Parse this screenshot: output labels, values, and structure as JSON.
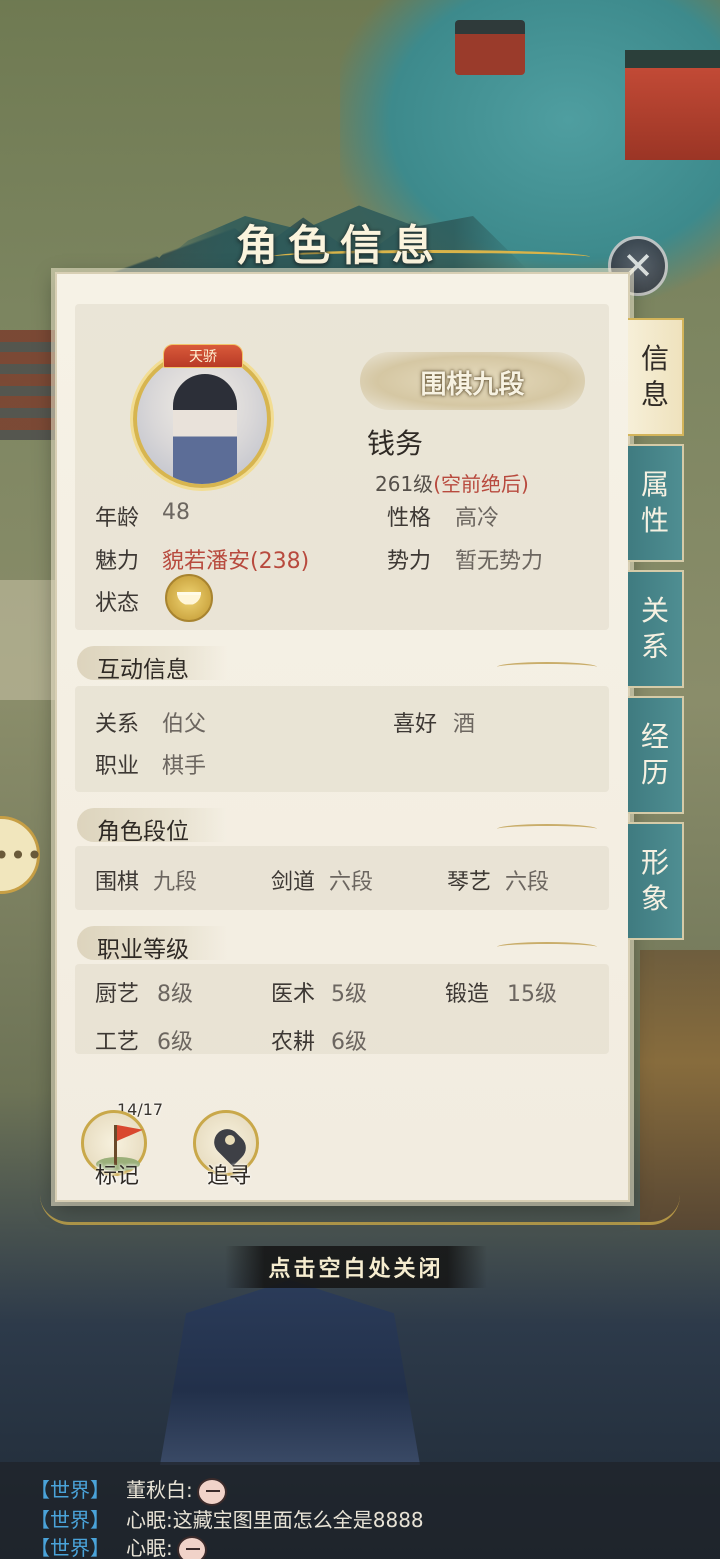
{
  "header": {
    "title": "角色信息"
  },
  "profile": {
    "ribbon": "天骄",
    "rank_badge": "围棋九段",
    "name": "钱务",
    "level": "261级",
    "level_title": "(空前绝后)"
  },
  "basic_info": {
    "age_label": "年龄",
    "age_value": "48",
    "personality_label": "性格",
    "personality_value": "高冷",
    "charm_label": "魅力",
    "charm_value": "貌若潘安(238)",
    "faction_label": "势力",
    "faction_value": "暂无势力",
    "status_label": "状态",
    "status_icon": "bowl-icon"
  },
  "interaction": {
    "title": "互动信息",
    "relation_label": "关系",
    "relation_value": "伯父",
    "hobby_label": "喜好",
    "hobby_value": "酒",
    "job_label": "职业",
    "job_value": "棋手"
  },
  "ranks": {
    "title": "角色段位",
    "items": [
      {
        "label": "围棋",
        "value": "九段"
      },
      {
        "label": "剑道",
        "value": "六段"
      },
      {
        "label": "琴艺",
        "value": "六段"
      }
    ]
  },
  "job_levels": {
    "title": "职业等级",
    "items": [
      {
        "label": "厨艺",
        "value": "8级"
      },
      {
        "label": "医术",
        "value": "5级"
      },
      {
        "label": "锻造",
        "value": "15级"
      },
      {
        "label": "工艺",
        "value": "6级"
      },
      {
        "label": "农耕",
        "value": "6级"
      }
    ]
  },
  "actions": {
    "mark_label": "标记",
    "mark_count": "14/17",
    "track_label": "追寻"
  },
  "tabs": [
    {
      "chars": [
        "信",
        "息"
      ],
      "active": true
    },
    {
      "chars": [
        "属",
        "性"
      ],
      "active": false
    },
    {
      "chars": [
        "关",
        "系"
      ],
      "active": false
    },
    {
      "chars": [
        "经",
        "历"
      ],
      "active": false
    },
    {
      "chars": [
        "形",
        "象"
      ],
      "active": false
    }
  ],
  "close_hint": "点击空白处关闭",
  "chat": [
    {
      "channel": "【世界】",
      "user": "董秋白:",
      "message": "",
      "emoji": true
    },
    {
      "channel": "【世界】",
      "user": "心眠:",
      "message": "这藏宝图里面怎么全是8888",
      "emoji": false
    },
    {
      "channel": "【世界】",
      "user": "心眠:",
      "message": "",
      "emoji": true
    }
  ],
  "colors": {
    "accent_red": "#b84a3e",
    "tab_teal": "#3f7b80",
    "gold": "#c9a84a",
    "chat_channel": "#4aa3d9"
  }
}
